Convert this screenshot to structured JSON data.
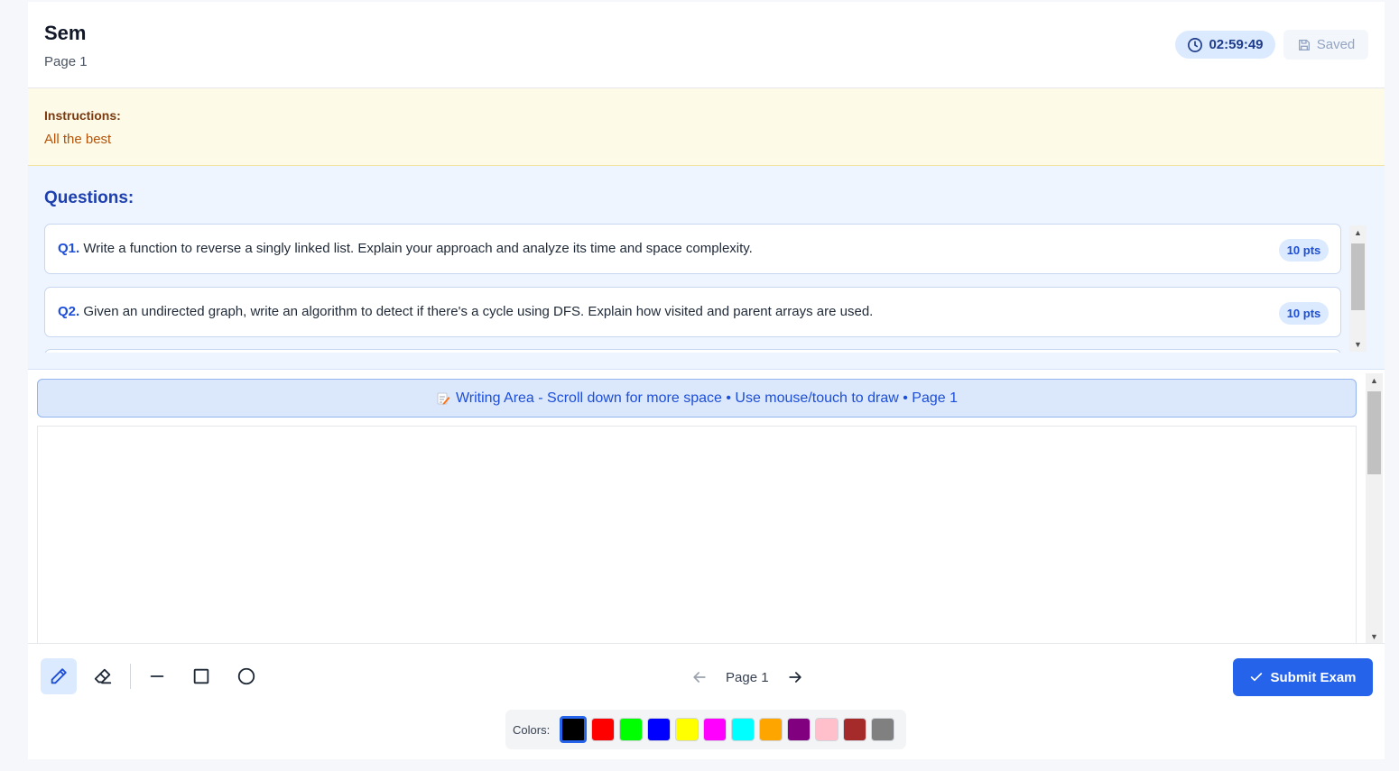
{
  "header": {
    "title": "Sem",
    "subtitle": "Page 1",
    "timer": "02:59:49",
    "saved_label": "Saved"
  },
  "instructions": {
    "label": "Instructions:",
    "text": "All the best"
  },
  "questions": {
    "heading": "Questions:",
    "items": [
      {
        "number": "Q1.",
        "text": " Write a function to reverse a singly linked list. Explain your approach and analyze its time and space complexity.",
        "points": "10 pts"
      },
      {
        "number": "Q2.",
        "text": " Given an undirected graph, write an algorithm to detect if there's a cycle using DFS. Explain how visited and parent arrays are used.",
        "points": "10 pts"
      }
    ]
  },
  "writing_area": {
    "banner": "Writing Area - Scroll down for more space • Use mouse/touch to draw • Page 1"
  },
  "toolbar": {
    "tools": [
      "pen-icon",
      "eraser-icon",
      "line-icon",
      "rectangle-icon",
      "circle-icon"
    ],
    "active_tool": "pen",
    "page_label": "Page 1",
    "submit_label": "Submit Exam"
  },
  "colors": {
    "label": "Colors:",
    "selected": "#000000",
    "swatches": [
      "#000000",
      "#ff0000",
      "#00ff00",
      "#0000ff",
      "#ffff00",
      "#ff00ff",
      "#00ffff",
      "#ffa500",
      "#800080",
      "#ffc0cb",
      "#a52a2a",
      "#808080"
    ]
  }
}
